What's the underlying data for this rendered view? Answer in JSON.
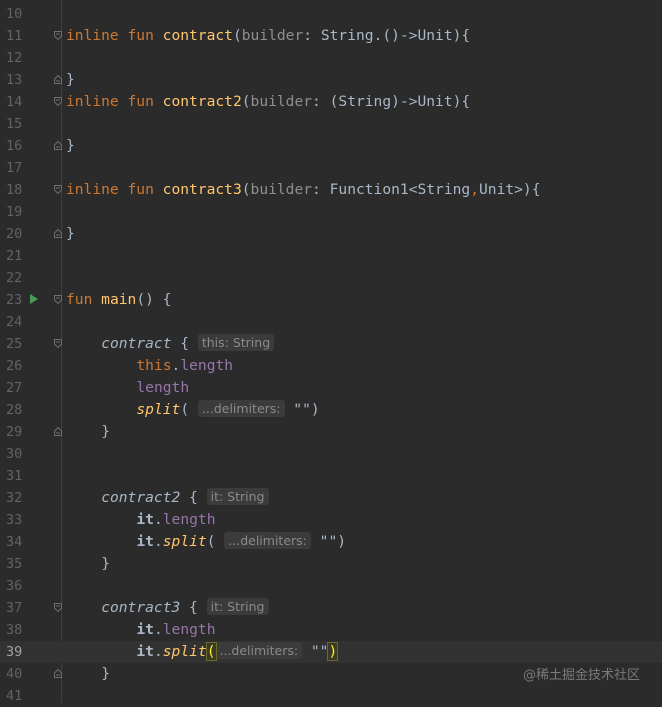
{
  "editor": {
    "current_line": "39",
    "lines": [
      {
        "n": "10",
        "t": ""
      },
      {
        "n": "11",
        "kw": "inline fun ",
        "fn": "contract",
        "p1": "(",
        "param": "builder",
        "p2": ": String.()->Unit){"
      },
      {
        "n": "12",
        "t": ""
      },
      {
        "n": "13",
        "t": "}"
      },
      {
        "n": "14",
        "kw": "inline fun ",
        "fn": "contract2",
        "p1": "(",
        "param": "builder",
        "p2": ": (String)->Unit){"
      },
      {
        "n": "15",
        "t": ""
      },
      {
        "n": "16",
        "t": "}"
      },
      {
        "n": "17",
        "t": ""
      },
      {
        "n": "18",
        "kw": "inline fun ",
        "fn": "contract3",
        "p1": "(",
        "param": "builder",
        "p2a": ": Function1<String",
        "comma": ",",
        "p2b": "Unit>){"
      },
      {
        "n": "19",
        "t": ""
      },
      {
        "n": "20",
        "t": "}"
      },
      {
        "n": "21",
        "t": ""
      },
      {
        "n": "22",
        "t": ""
      },
      {
        "n": "23",
        "kw": "fun ",
        "fn": "main",
        "p2": "() {"
      },
      {
        "n": "24",
        "t": ""
      },
      {
        "n": "25",
        "call": "contract",
        "brace": " { ",
        "hint": "this: String"
      },
      {
        "n": "26",
        "this": "this",
        "dot": ".",
        "prop": "length"
      },
      {
        "n": "27",
        "prop": "length"
      },
      {
        "n": "28",
        "ext": "split",
        "open": "( ",
        "hint": "...delimiters:",
        "str": " \"\"",
        "close": ")"
      },
      {
        "n": "29",
        "t": "}"
      },
      {
        "n": "30",
        "t": ""
      },
      {
        "n": "31",
        "t": ""
      },
      {
        "n": "32",
        "call": "contract2",
        "brace": " { ",
        "hint": "it: String"
      },
      {
        "n": "33",
        "it": "it",
        "dot": ".",
        "prop": "length"
      },
      {
        "n": "34",
        "it": "it",
        "dot": ".",
        "ext": "split",
        "open": "( ",
        "hint": "...delimiters:",
        "str": " \"\"",
        "close": ")"
      },
      {
        "n": "35",
        "t": "}"
      },
      {
        "n": "36",
        "t": ""
      },
      {
        "n": "37",
        "call": "contract3",
        "brace": " { ",
        "hint": "it: String"
      },
      {
        "n": "38",
        "it": "it",
        "dot": ".",
        "prop": "length"
      },
      {
        "n": "39",
        "it": "it",
        "dot": ".",
        "ext": "split",
        "open": "(",
        "hint": "...delimiters:",
        "str": " \"\"",
        "close": ")"
      },
      {
        "n": "40",
        "t": "}"
      },
      {
        "n": "41",
        "t": ""
      }
    ]
  },
  "watermark": "@稀土掘金技术社区",
  "colors": {
    "background": "#2b2b2b",
    "keyword": "#cc7832",
    "function": "#ffc66d",
    "property": "#9876aa",
    "text": "#a9b7c6"
  }
}
